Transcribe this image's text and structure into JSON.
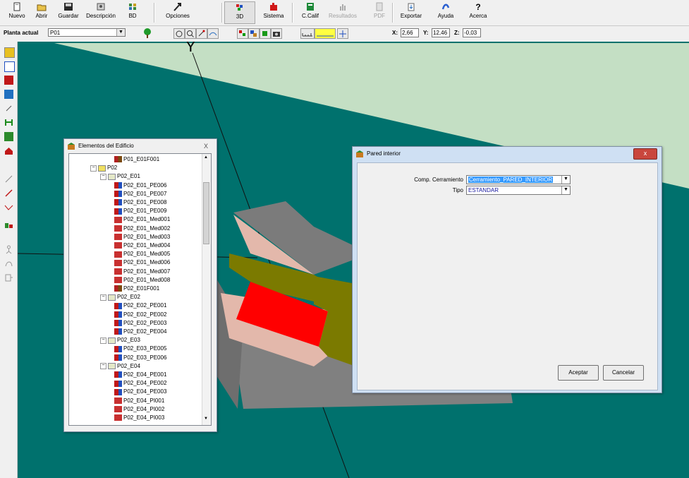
{
  "toolbar": {
    "buttons": [
      {
        "label": "Nuevo",
        "icon": "new-document-icon"
      },
      {
        "label": "Abrir",
        "icon": "open-folder-icon"
      },
      {
        "label": "Guardar",
        "icon": "save-disk-icon"
      },
      {
        "label": "Descripción",
        "icon": "description-icon"
      },
      {
        "label": "BD",
        "icon": "database-icon"
      },
      {
        "label": "Opciones",
        "icon": "options-icon"
      },
      {
        "label": "3D",
        "icon": "3d-view-icon"
      },
      {
        "label": "Sistema",
        "icon": "system-icon"
      },
      {
        "label": "C.Calif",
        "icon": "energy-rating-icon"
      },
      {
        "label": "Resultados",
        "icon": "results-icon"
      },
      {
        "label": "PDF",
        "icon": "pdf-icon"
      },
      {
        "label": "Exportar",
        "icon": "export-icon"
      },
      {
        "label": "Ayuda",
        "icon": "help-icon"
      },
      {
        "label": "Acerca",
        "icon": "about-icon"
      }
    ]
  },
  "plant": {
    "label": "Planta actual",
    "value": "P01"
  },
  "coords": {
    "x_label": "X:",
    "x": "2,66",
    "y_label": "Y:",
    "y": "12,46",
    "z_label": "Z:",
    "z": "-0,03"
  },
  "viewport": {
    "axis_label": "Y",
    "colors": {
      "ground": "#00716d",
      "sky": "#c4dfc4",
      "wall_red": "#ff0000",
      "wall_olive": "#7b7a00",
      "floor_pink": "#e3b8ab",
      "grey": "#808080"
    }
  },
  "tree_window": {
    "title": "Elementos del Edificio",
    "close": "X",
    "rows": [
      "P01_E01F001",
      "P02",
      "P02_E01",
      "P02_E01_PE006",
      "P02_E01_PE007",
      "P02_E01_PE008",
      "P02_E01_PE009",
      "P02_E01_Med001",
      "P02_E01_Med002",
      "P02_E01_Med003",
      "P02_E01_Med004",
      "P02_E01_Med005",
      "P02_E01_Med006",
      "P02_E01_Med007",
      "P02_E01_Med008",
      "P02_E01F001",
      "P02_E02",
      "P02_E02_PE001",
      "P02_E02_PE002",
      "P02_E02_PE003",
      "P02_E02_PE004",
      "P02_E03",
      "P02_E03_PE005",
      "P02_E03_PE006",
      "P02_E04",
      "P02_E04_PE001",
      "P02_E04_PE002",
      "P02_E04_PE003",
      "P02_E04_PI001",
      "P02_E04_PI002",
      "P02_E04_PI003"
    ]
  },
  "dialog": {
    "title": "Pared interior",
    "close": "x",
    "comp_label": "Comp. Cerramiento",
    "comp_value": "Cerramiento_PARED_INTERIOR",
    "tipo_label": "Tipo",
    "tipo_value": "ESTANDAR",
    "accept": "Aceptar",
    "cancel": "Cancelar"
  }
}
